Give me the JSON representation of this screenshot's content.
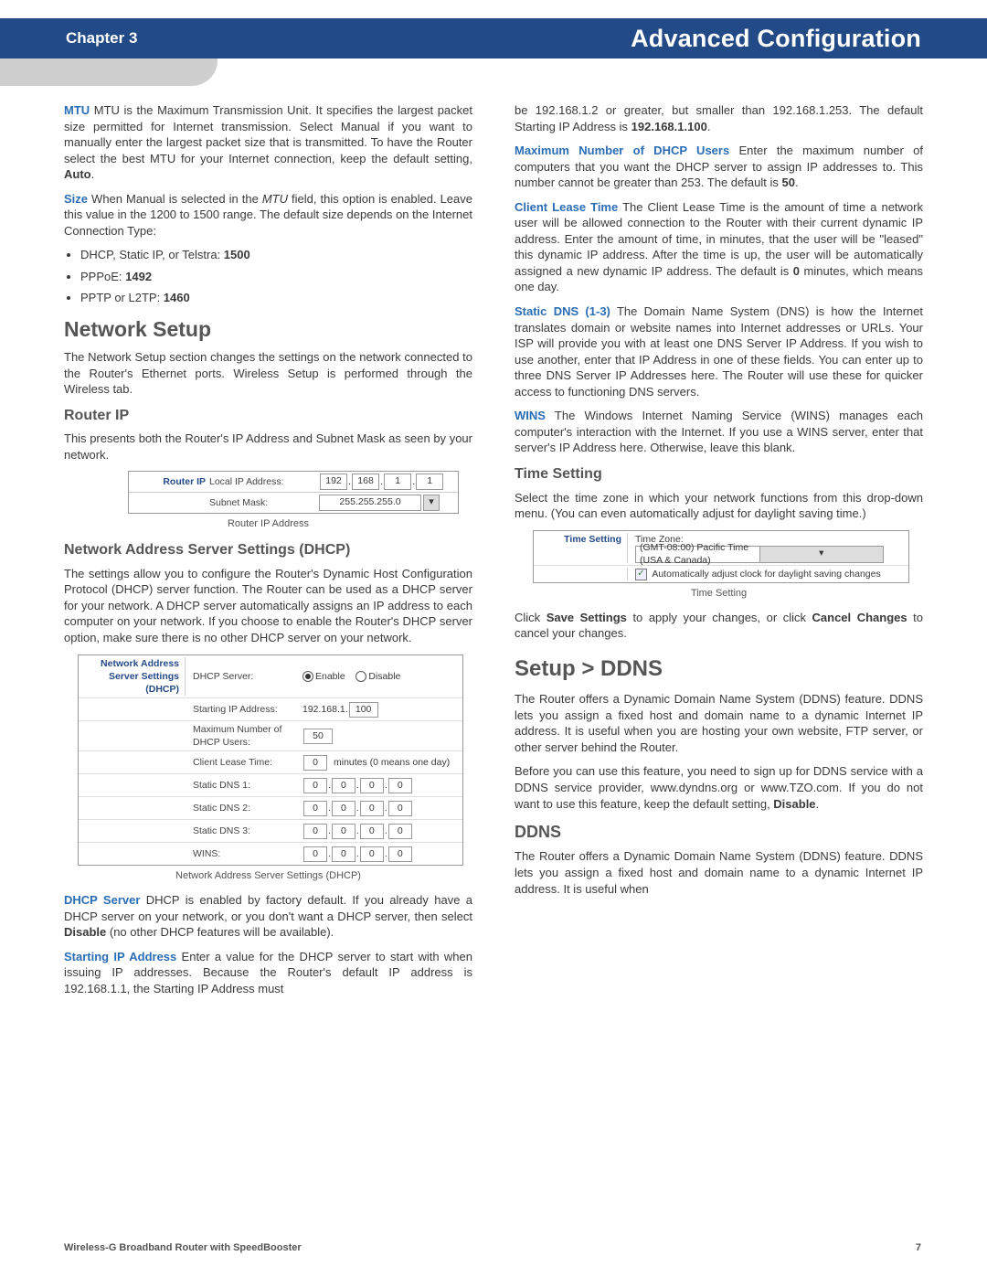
{
  "header": {
    "chapter": "Chapter 3",
    "title": "Advanced Configuration"
  },
  "mtu": {
    "term": "MTU",
    "body": "  MTU is the Maximum Transmission Unit. It specifies the largest packet size permitted for Internet transmission. Select Manual if you want to manually enter the largest packet size that is transmitted. To have the Router select the best MTU for your Internet connection, keep the default setting, ",
    "auto": "Auto",
    "tail": "."
  },
  "size": {
    "term": "Size",
    "body": "  When Manual is selected in the ",
    "mtu_i": "MTU",
    "body2": " field, this option is enabled. Leave this value in the 1200 to 1500 range. The default size depends on the Internet Connection Type:"
  },
  "bullets": {
    "b1a": "DHCP, Static IP, or Telstra: ",
    "b1b": "1500",
    "b2a": "PPPoE: ",
    "b2b": "1492",
    "b3a": "PPTP or L2TP: ",
    "b3b": "1460"
  },
  "netsetup": {
    "h": "Network Setup",
    "p": "The Network Setup section changes the settings on the network connected to the Router's Ethernet ports. Wireless Setup is performed through the Wireless tab."
  },
  "routerip": {
    "h": "Router IP",
    "p": "This presents both the Router's IP Address and Subnet Mask as seen by your network.",
    "side": "Router IP",
    "l1": "Local IP Address:",
    "l2": "Subnet Mask:",
    "ip": [
      "192",
      "168",
      "1",
      "1"
    ],
    "mask": "255.255.255.0",
    "caption": "Router IP Address"
  },
  "dhcp": {
    "h": "Network Address Server Settings (DHCP)",
    "p": "The settings allow you to configure the Router's Dynamic Host Configuration Protocol (DHCP) server function. The Router can be used as a DHCP server for your network. A DHCP server automatically assigns an IP address to each computer on your network. If you choose to enable the Router's DHCP server option, make sure there is no other DHCP server on your network.",
    "side1": "Network Address",
    "side2": "Server Settings (DHCP)",
    "row_server": "DHCP Server:",
    "enable": "Enable",
    "disable": "Disable",
    "row_sip": "Starting IP Address:",
    "sip_prefix": "192.168.1.",
    "sip_val": "100",
    "row_max": "Maximum Number of DHCP Users:",
    "max_val": "50",
    "row_lease": "Client Lease Time:",
    "lease_val": "0",
    "lease_suffix": "minutes (0 means one day)",
    "rows_dns": [
      "Static DNS 1:",
      "Static DNS 2:",
      "Static DNS 3:"
    ],
    "row_wins": "WINS:",
    "zero": "0",
    "caption": "Network Address Server Settings (DHCP)"
  },
  "dhcpserver": {
    "term": "DHCP Server",
    "body": "  DHCP is enabled by factory default. If you already have a DHCP server on your network, or you don't want a DHCP server, then select ",
    "disable": "Disable",
    "tail": " (no other DHCP features will be available)."
  },
  "startip": {
    "term": "Starting IP Address",
    "body": "  Enter a value for the DHCP server to start with when issuing IP addresses. Because the Router's default IP address is 192.168.1.1, the Starting IP Address must"
  },
  "rcol": {
    "cont": "be 192.168.1.2 or greater, but smaller than 192.168.1.253. The default Starting IP Address is ",
    "contb": "192.168.1.100",
    "contt": "."
  },
  "maxusers": {
    "term": "Maximum Number of DHCP Users",
    "body": "  Enter the maximum number of computers that you want the DHCP server to assign IP addresses to. This number cannot be greater than 253. The default is ",
    "b": "50",
    "t": "."
  },
  "clt": {
    "term": "Client Lease Time",
    "body": "  The Client Lease Time is the amount of time a network user will be allowed connection to the Router with their current dynamic IP address. Enter the amount of time, in minutes, that the user will be \"leased\" this dynamic IP address. After the time is up, the user will be automatically assigned a new dynamic IP address. The default is ",
    "b": "0",
    "t": " minutes, which means one day."
  },
  "sdns": {
    "term": "Static DNS (1-3)",
    "body": "  The Domain Name System (DNS) is how the Internet translates domain or website names into Internet addresses or URLs. Your ISP will provide you with at least one DNS Server IP Address. If you wish to use another, enter that IP Address in one of these fields. You can enter up to three DNS Server IP Addresses here. The Router will use these for quicker access to functioning DNS servers."
  },
  "wins": {
    "term": "WINS",
    "body": " The Windows Internet Naming Service (WINS) manages each computer's interaction with the Internet. If you use a WINS server, enter that server's IP Address here. Otherwise, leave this blank."
  },
  "timesetting": {
    "h": "Time Setting",
    "p": "Select the time zone in which your network functions from this drop-down menu. (You can even automatically adjust for daylight saving time.)",
    "side": "Time Setting",
    "label": "Time Zone:",
    "dropdown": "(GMT-08:00) Pacific Time (USA & Canada)",
    "check": "Automatically adjust clock for daylight saving changes",
    "caption": "Time Setting"
  },
  "save": {
    "a": "Click ",
    "b1": "Save Settings",
    "m": " to apply your changes, or click ",
    "b2": "Cancel Changes",
    "t": " to cancel your changes."
  },
  "ddns": {
    "h": "Setup > DDNS",
    "p1": "The Router offers a Dynamic Domain Name System (DDNS) feature. DDNS lets you assign a fixed host and domain name to a dynamic Internet IP address. It is useful when you are hosting your own website, FTP server, or other server behind the Router.",
    "p2a": "Before you can use this feature, you need to sign up for DDNS service with a DDNS service provider, www.dyndns.org or www.TZO.com. If you do not want to use this feature, keep the default setting, ",
    "p2b": "Disable",
    "p2t": ".",
    "h2": "DDNS",
    "p3": "The Router offers a Dynamic Domain Name System (DDNS) feature. DDNS lets you assign a fixed host and domain name to a dynamic Internet IP address. It is useful when"
  },
  "footer": {
    "left": "Wireless-G Broadband Router with SpeedBooster",
    "right": "7"
  }
}
